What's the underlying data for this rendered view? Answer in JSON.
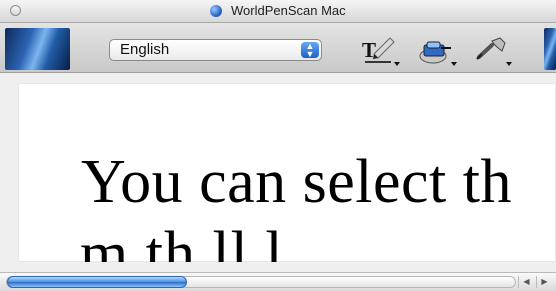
{
  "window": {
    "title": "WorldPenScan Mac"
  },
  "toolbar": {
    "language_value": "English",
    "icons": {
      "window_control": "window-control-icon",
      "app": "worldpenscan-icon",
      "text": "text-tool-icon",
      "scan": "scan-icon",
      "settings": "settings-tool-icon"
    }
  },
  "content": {
    "line1": "You can select th",
    "line2": "m        th             ll    l"
  },
  "colors": {
    "accent": "#2b68c6",
    "scroll_thumb": "#4c93e8",
    "blue_panel": "#2b63b2"
  },
  "scroll": {
    "thumb_fraction": 0.35
  }
}
